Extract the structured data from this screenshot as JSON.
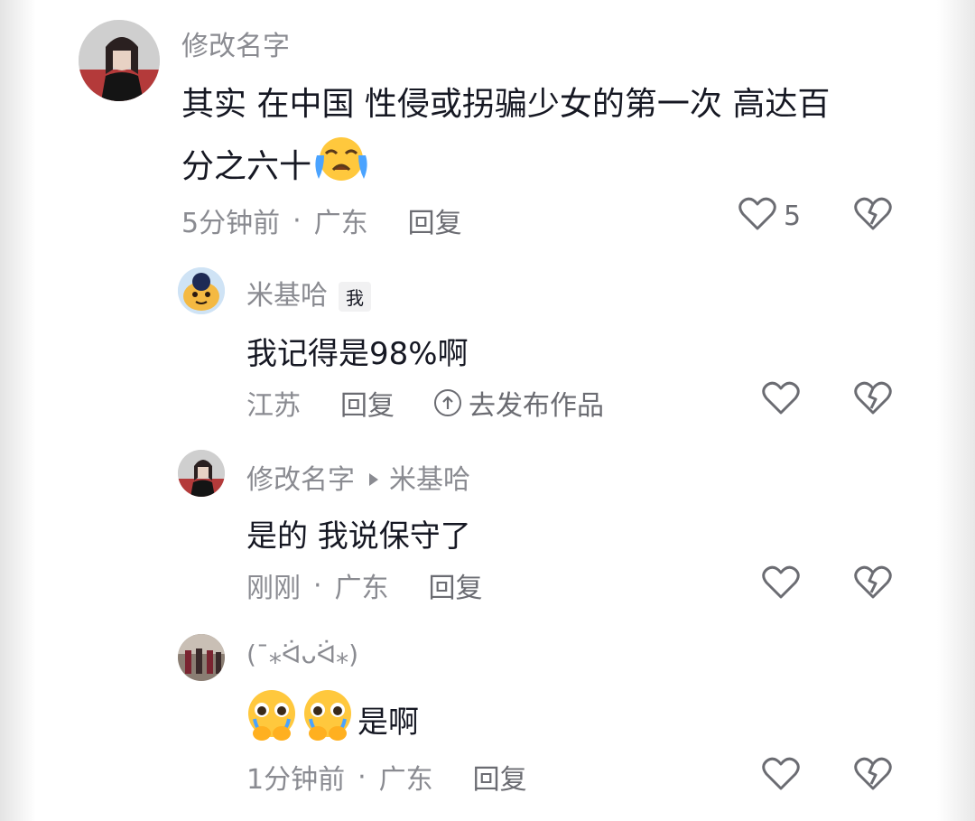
{
  "comments": [
    {
      "username": "修改名字",
      "text_line1": "其实 在中国 性侵或拐骗少女的第一次 高达百",
      "text_line2": "分之六十",
      "emoji": "loudly-crying-face",
      "time": "5分钟前",
      "location": "广东",
      "reply_label": "回复",
      "likes": "5"
    },
    {
      "username": "米基哈",
      "badge": "我",
      "text": "我记得是98%啊",
      "location": "江苏",
      "reply_label": "回复",
      "publish_label": "去发布作品"
    },
    {
      "username": "修改名字",
      "reply_to": "米基哈",
      "text": "是的 我说保守了",
      "time": "刚刚",
      "location": "广东",
      "reply_label": "回复"
    },
    {
      "username": "(ˉ⁎ᐛᴗᐛ⁎)",
      "emoji": "pleading-face-holding-back-tears",
      "text": "是啊",
      "time": "1分钟前",
      "location": "广东",
      "reply_label": "回复"
    }
  ],
  "separator": "·"
}
